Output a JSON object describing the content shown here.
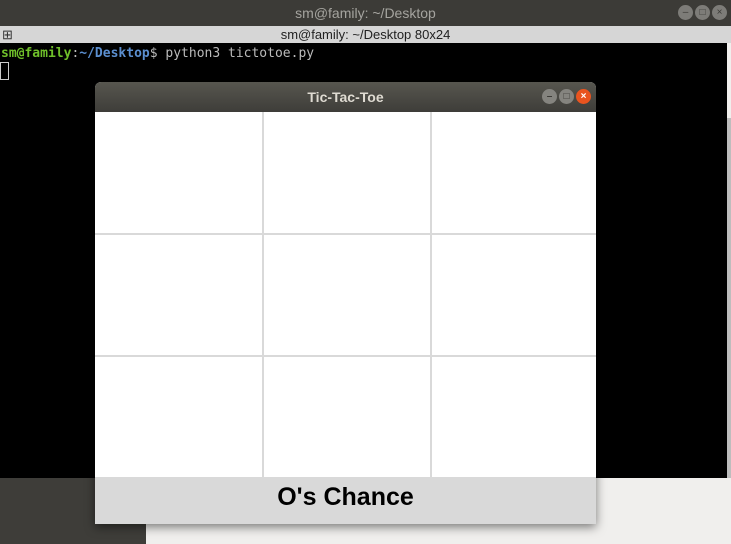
{
  "terminal": {
    "window_title": "sm@family: ~/Desktop",
    "tab_title": "sm@family: ~/Desktop 80x24",
    "prompt_user": "sm@family",
    "prompt_sep": ":",
    "prompt_path": "~/Desktop",
    "prompt_dollar": "$",
    "command": " python3 tictotoe.py"
  },
  "game": {
    "window_title": "Tic-Tac-Toe",
    "cells": [
      "",
      "",
      "",
      "",
      "",
      "",
      "",
      "",
      ""
    ],
    "status": "O's Chance"
  },
  "window_buttons": {
    "minimize": "–",
    "maximize": "□",
    "close": "×"
  }
}
